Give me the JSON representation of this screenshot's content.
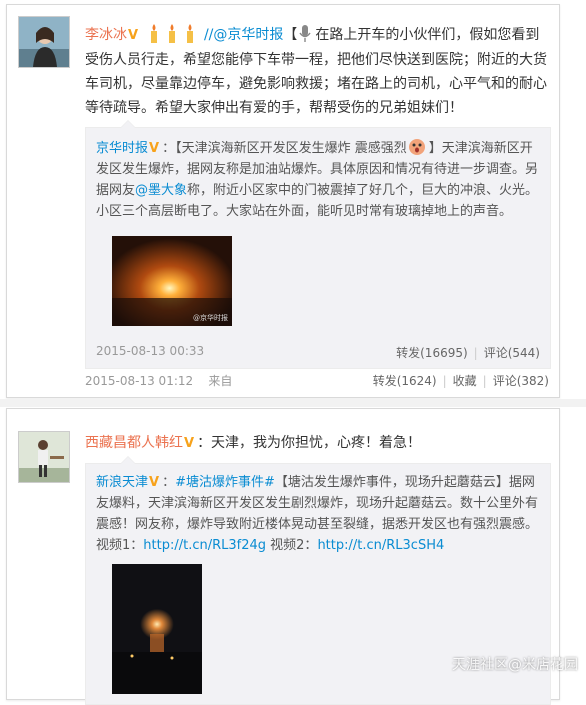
{
  "post1": {
    "author": "李冰冰",
    "mention": "//@京华时报",
    "bracket_open": "【",
    "text": "在路上开车的小伙伴们，假如您看到受伤人员行走，希望您能停下车带一程，把他们尽快送到医院；附近的大货车司机，尽量靠边停车，避免影响救援；堵在路上的司机，心平气和的耐心等待疏导。希望大家伸出有爱的手，帮帮受伤的兄弟姐妹们！",
    "date": "2015-08-13 01:12",
    "source": "来自",
    "repost_label": "转发(1624)",
    "collect_label": "收藏",
    "comment_label": "评论(382)",
    "original": {
      "author": "京华时报",
      "title": "【天津滨海新区开发区发生爆炸 震感强烈",
      "text_before": "】天津滨海新区开发区发生爆炸，据网友称是加油站爆炸。具体原因和情况有待进一步调查。另据网友",
      "mention": "@墨大象",
      "text_after": "称，附近小区家中的门被震掉了好几个，巨大的冲浪、火光。小区三个高层断电了。大家站在外面，能听见时常有玻璃掉地上的声音。",
      "image_caption": "@京华时报",
      "date": "2015-08-13 00:33",
      "repost_label": "转发(16695)",
      "comment_label": "评论(544)"
    }
  },
  "post2": {
    "author": "西藏昌都人韩红",
    "text": "：天津，我为你担忧，心疼！着急！",
    "original": {
      "author": "新浪天津",
      "topic": "#塘沽爆炸事件#",
      "text_a": "【塘沽发生爆炸事件，现场升起蘑菇云】据网友爆料，天津滨海新区开发区发生剧烈爆炸，现场升起蘑菇云。数十公里外有震感！网友称，爆炸导致附近楼体晃动甚至裂缝，据悉开发区也有强烈震感。视频1：",
      "link1": "http://t.cn/RL3f24g",
      "text_b": " 视频2：",
      "link2": "http://t.cn/RL3cSH4"
    }
  },
  "watermark": "天涯社区@米店花园"
}
